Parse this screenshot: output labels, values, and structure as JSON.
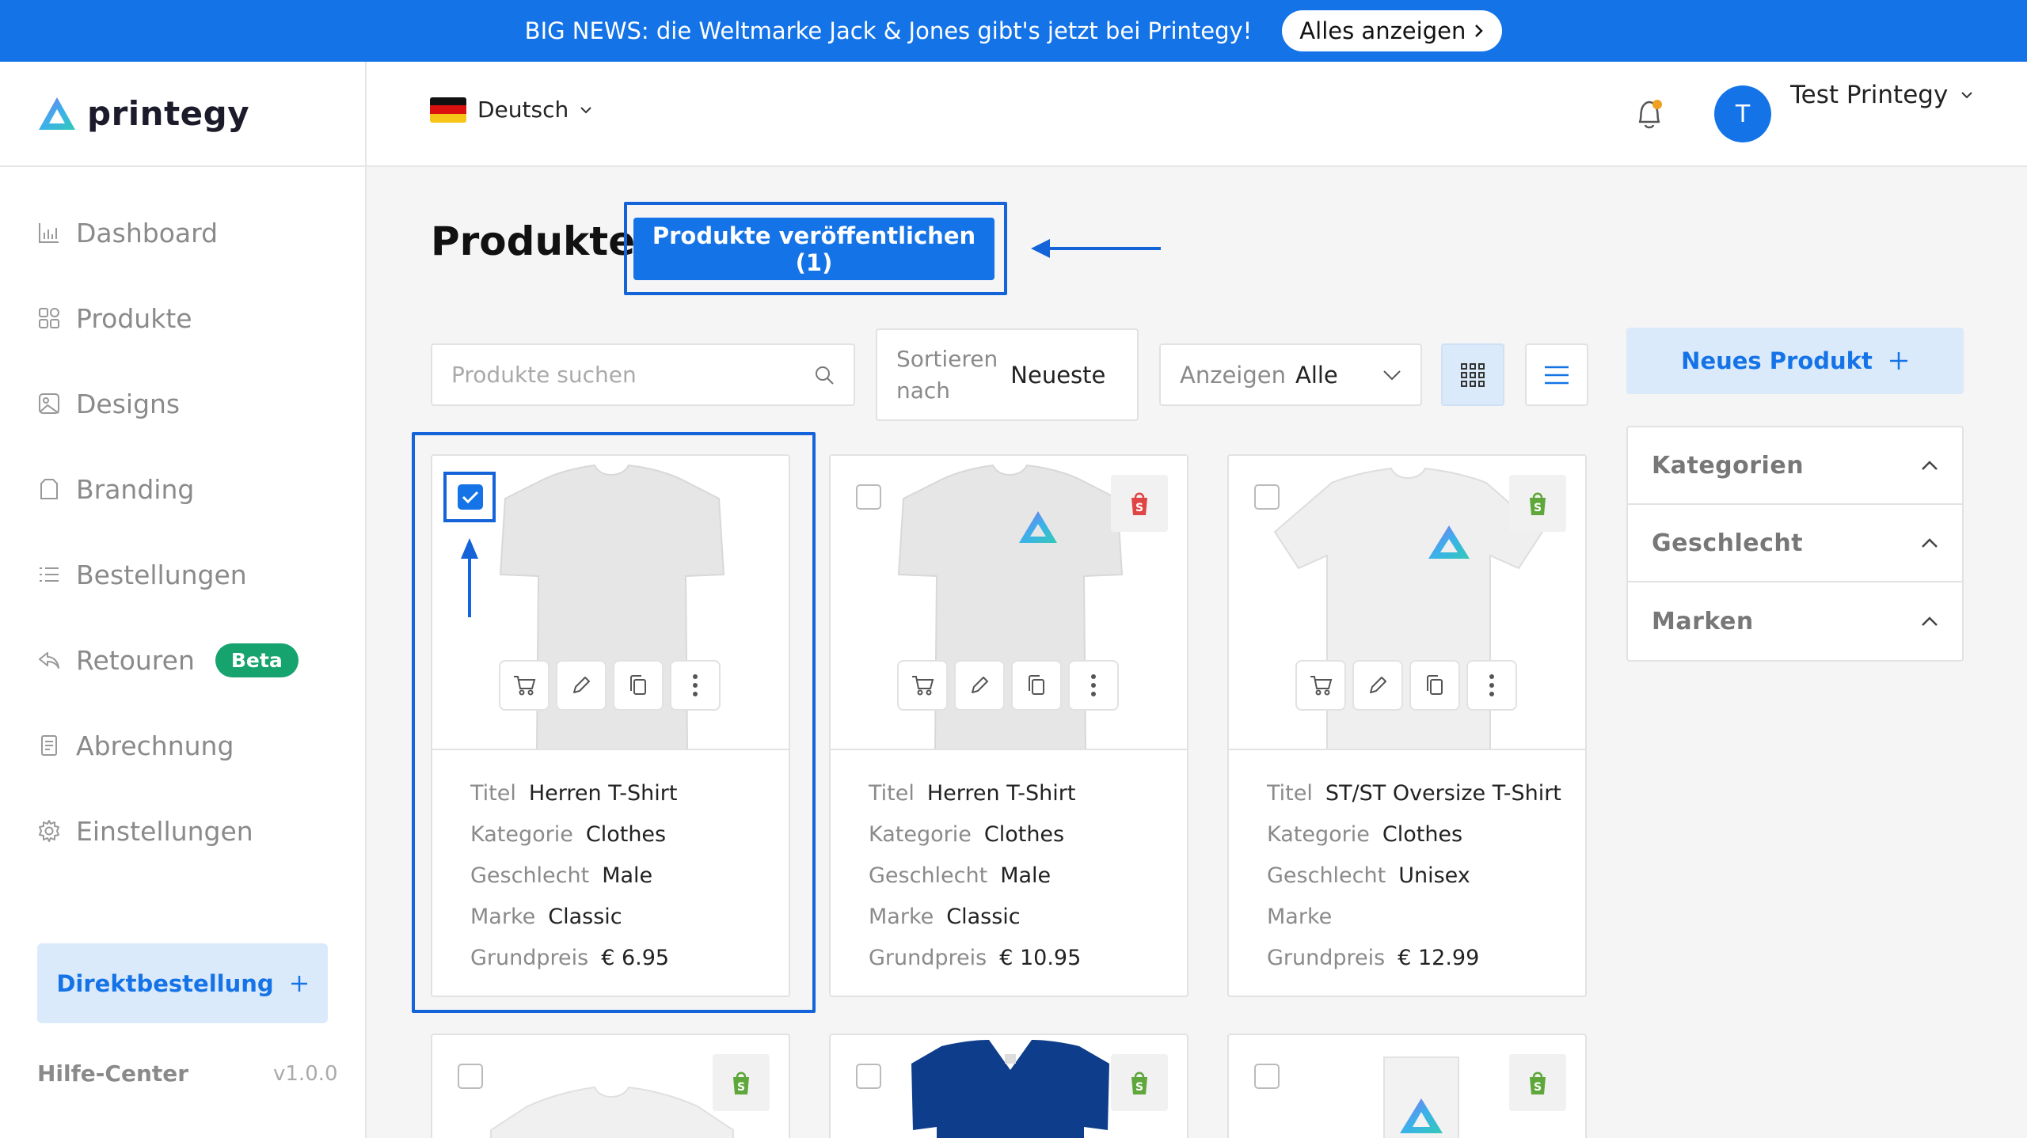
{
  "banner": {
    "text": "BIG NEWS: die Weltmarke Jack & Jones gibt's jetzt bei Printegy!",
    "button_label": "Alles anzeigen"
  },
  "brand": {
    "name": "printegy"
  },
  "language": {
    "label": "Deutsch"
  },
  "user": {
    "initial": "T",
    "name": "Test Printegy"
  },
  "sidebar": {
    "items": [
      {
        "label": "Dashboard",
        "icon": "bar-chart-icon"
      },
      {
        "label": "Produkte",
        "icon": "grid-icon"
      },
      {
        "label": "Designs",
        "icon": "image-icon"
      },
      {
        "label": "Branding",
        "icon": "bag-icon"
      },
      {
        "label": "Bestellungen",
        "icon": "list-icon"
      },
      {
        "label": "Retouren",
        "icon": "return-icon",
        "badge": "Beta"
      },
      {
        "label": "Abrechnung",
        "icon": "receipt-icon"
      },
      {
        "label": "Einstellungen",
        "icon": "gear-icon"
      }
    ],
    "direct_order_label": "Direktbestellung",
    "help_label": "Hilfe-Center",
    "version": "v1.0.0"
  },
  "main": {
    "title": "Produkte",
    "publish_label": "Produkte veröffentlichen (1)",
    "search_placeholder": "Produkte suchen",
    "sort": {
      "label": "Sortieren nach",
      "value": "Neueste"
    },
    "show": {
      "label": "Anzeigen",
      "value": "Alle"
    },
    "new_product_label": "Neues Produkt"
  },
  "filters": [
    "Kategorien",
    "Geschlecht",
    "Marken"
  ],
  "field_labels": {
    "title": "Titel",
    "category": "Kategorie",
    "gender": "Geschlecht",
    "brand": "Marke",
    "price": "Grundpreis"
  },
  "products": [
    {
      "title": "Herren T-Shirt",
      "category": "Clothes",
      "gender": "Male",
      "brand": "Classic",
      "price": "€ 6.95",
      "checked": true,
      "shop": ""
    },
    {
      "title": "Herren T-Shirt",
      "category": "Clothes",
      "gender": "Male",
      "brand": "Classic",
      "price": "€ 10.95",
      "checked": false,
      "shop": "shop-red"
    },
    {
      "title": "ST/ST Oversize T-Shirt",
      "category": "Clothes",
      "gender": "Unisex",
      "brand": "",
      "price": "€ 12.99",
      "checked": false,
      "shop": "shopify"
    }
  ],
  "colors": {
    "accent": "#1473e6",
    "beta": "#16a36e",
    "light_accent": "#dbeafb"
  }
}
